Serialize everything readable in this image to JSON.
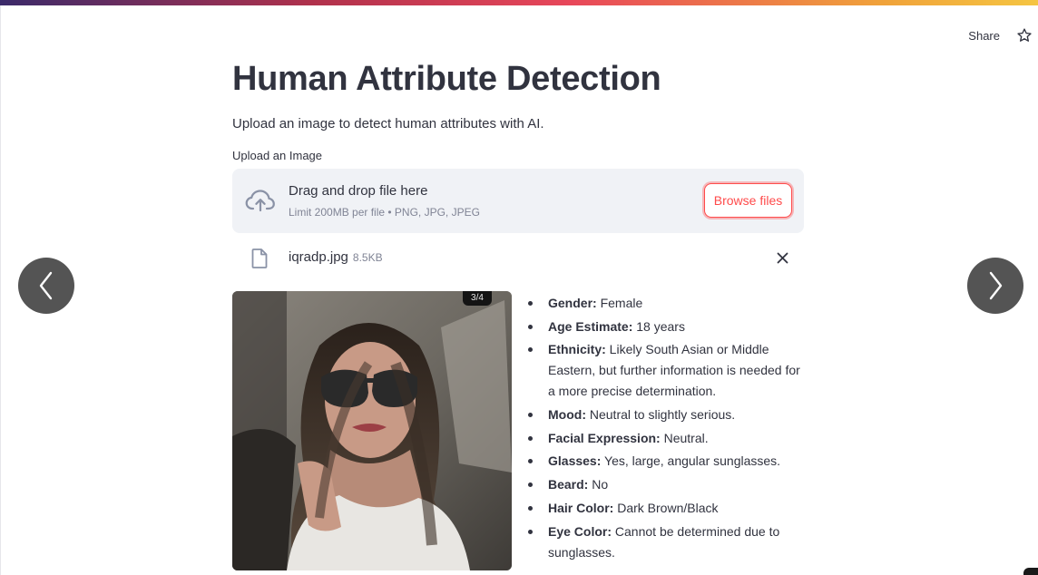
{
  "header": {
    "share_label": "Share",
    "star_icon": "star-icon"
  },
  "main": {
    "title": "Human Attribute Detection",
    "subtitle": "Upload an image to detect human attributes with AI.",
    "upload_label": "Upload an Image",
    "dropzone": {
      "icon": "cloud-upload-icon",
      "title": "Drag and drop file here",
      "limit": "Limit 200MB per file • PNG, JPG, JPEG",
      "browse_label": "Browse files"
    },
    "file": {
      "icon": "file-icon",
      "name": "iqradp.jpg",
      "size": "8.5KB",
      "remove_icon": "close-icon"
    },
    "photo": {
      "badge": "3/4"
    },
    "attributes": [
      {
        "key": "Gender:",
        "value": " Female"
      },
      {
        "key": "Age Estimate:",
        "value": " 18 years"
      },
      {
        "key": "Ethnicity:",
        "value": " Likely South Asian or Middle Eastern, but further information is needed for a more precise determination."
      },
      {
        "key": "Mood:",
        "value": " Neutral to slightly serious."
      },
      {
        "key": "Facial Expression:",
        "value": " Neutral."
      },
      {
        "key": "Glasses:",
        "value": " Yes, large, angular sunglasses."
      },
      {
        "key": "Beard:",
        "value": " No"
      },
      {
        "key": "Hair Color:",
        "value": " Dark Brown/Black"
      },
      {
        "key": "Eye Color:",
        "value": " Cannot be determined due to sunglasses."
      }
    ]
  },
  "navigation": {
    "prev_icon": "chevron-left-icon",
    "next_icon": "chevron-right-icon"
  },
  "colors": {
    "accent": "#ff4b4b",
    "text": "#31333f",
    "muted": "#808495",
    "dropzone_bg": "#f0f2f6"
  }
}
